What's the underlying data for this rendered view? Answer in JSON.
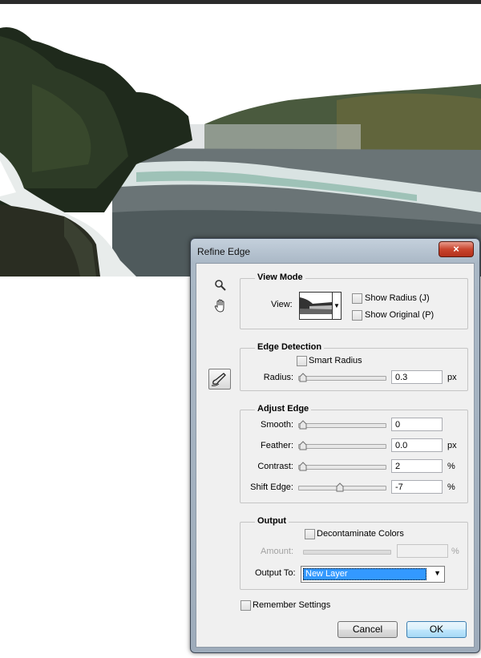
{
  "dialog": {
    "title": "Refine Edge",
    "close_symbol": "×"
  },
  "tools": [
    "zoom-icon",
    "hand-icon",
    "refine-radius-brush-icon"
  ],
  "view_mode": {
    "title": "View Mode",
    "view_label": "View:",
    "show_radius": {
      "label": "Show Radius (J)",
      "checked": false
    },
    "show_original": {
      "label": "Show Original (P)",
      "checked": false
    }
  },
  "edge_detection": {
    "title": "Edge Detection",
    "smart_radius": {
      "label": "Smart Radius",
      "checked": false
    },
    "radius": {
      "label": "Radius:",
      "value": "0.3",
      "unit": "px",
      "slider": 0.0
    }
  },
  "adjust_edge": {
    "title": "Adjust Edge",
    "smooth": {
      "label": "Smooth:",
      "value": "0",
      "unit": "",
      "slider": 0.0
    },
    "feather": {
      "label": "Feather:",
      "value": "0.0",
      "unit": "px",
      "slider": 0.0
    },
    "contrast": {
      "label": "Contrast:",
      "value": "2",
      "unit": "%",
      "slider": 0.0
    },
    "shift_edge": {
      "label": "Shift Edge:",
      "value": "-7",
      "unit": "%",
      "slider": 0.47
    }
  },
  "output": {
    "title": "Output",
    "decontaminate": {
      "label": "Decontaminate Colors",
      "checked": false
    },
    "amount": {
      "label": "Amount:",
      "value": "",
      "unit": "%"
    },
    "output_to": {
      "label": "Output To:",
      "value": "New Layer"
    }
  },
  "remember": {
    "label": "Remember Settings",
    "checked": false
  },
  "buttons": {
    "cancel": "Cancel",
    "ok": "OK"
  },
  "colors": {
    "accent": "#3399ff",
    "close": "#c9452e",
    "sky": "#ffffff",
    "water": "#5f6b6d"
  }
}
